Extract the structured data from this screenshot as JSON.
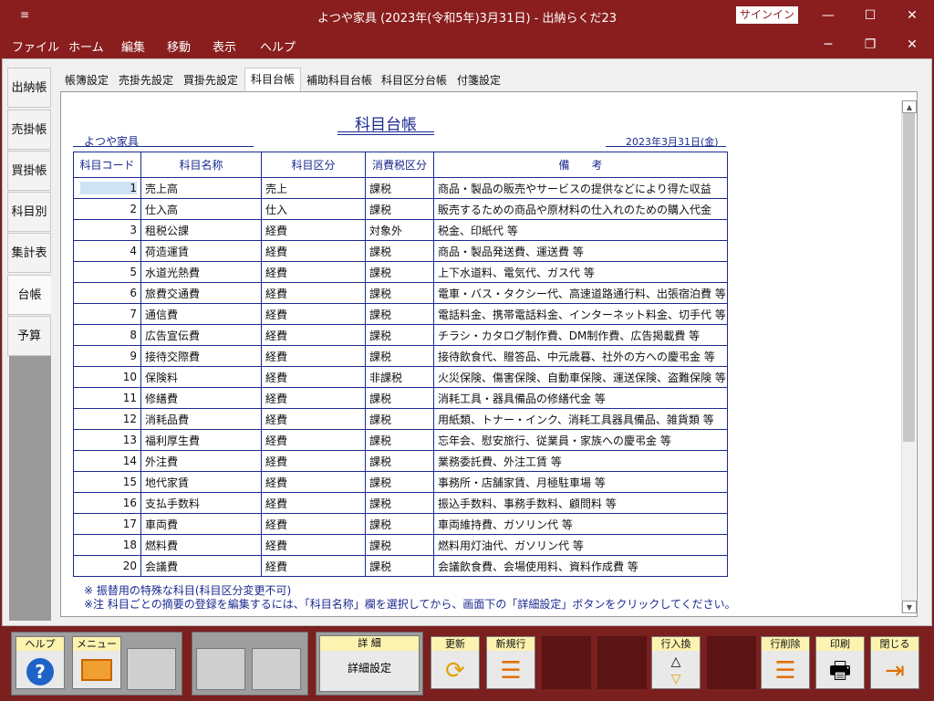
{
  "window": {
    "title": "よつや家具 (2023年(令和5年)3月31日)  -  出納らくだ23",
    "signin_label": "サインイン",
    "menu_icon": "≡"
  },
  "menu": [
    "ファイル",
    "ホーム",
    "編集",
    "移動",
    "表示",
    "ヘルプ"
  ],
  "side_tabs": [
    "出納帳",
    "売掛帳",
    "買掛帳",
    "科目別",
    "集計表",
    "台帳",
    "予算"
  ],
  "active_side_tab": "台帳",
  "top_tabs": [
    "帳簿設定",
    "売掛先設定",
    "買掛先設定",
    "科目台帳",
    "補助科目台帳",
    "科目区分台帳",
    "付箋設定"
  ],
  "active_top_tab": "科目台帳",
  "document": {
    "title": "科目台帳",
    "company": "よつや家具",
    "date": "2023年3月31日(金)"
  },
  "table": {
    "headers": [
      "科目コード",
      "科目名称",
      "科目区分",
      "消費税区分",
      "備　　考"
    ],
    "rows": [
      [
        "1",
        "売上高",
        "売上",
        "課税",
        "商品・製品の販売やサービスの提供などにより得た収益"
      ],
      [
        "2",
        "仕入高",
        "仕入",
        "課税",
        "販売するための商品や原材料の仕入れのための購入代金"
      ],
      [
        "3",
        "租税公課",
        "経費",
        "対象外",
        "税金、印紙代 等"
      ],
      [
        "4",
        "荷造運賃",
        "経費",
        "課税",
        "商品・製品発送費、運送費 等"
      ],
      [
        "5",
        "水道光熱費",
        "経費",
        "課税",
        "上下水道料、電気代、ガス代 等"
      ],
      [
        "6",
        "旅費交通費",
        "経費",
        "課税",
        "電車・バス・タクシー代、高速道路通行料、出張宿泊費 等"
      ],
      [
        "7",
        "通信費",
        "経費",
        "課税",
        "電話料金、携帯電話料金、インターネット料金、切手代 等"
      ],
      [
        "8",
        "広告宣伝費",
        "経費",
        "課税",
        "チラシ・カタログ制作費、DM制作費、広告掲載費 等"
      ],
      [
        "9",
        "接待交際費",
        "経費",
        "課税",
        "接待飲食代、贈答品、中元歳暮、社外の方への慶弔金 等"
      ],
      [
        "10",
        "保険料",
        "経費",
        "非課税",
        "火災保険、傷害保険、自動車保険、運送保険、盗難保険 等"
      ],
      [
        "11",
        "修繕費",
        "経費",
        "課税",
        "消耗工具・器具備品の修繕代金 等"
      ],
      [
        "12",
        "消耗品費",
        "経費",
        "課税",
        "用紙類、トナー・インク、消耗工具器具備品、雑貨類 等"
      ],
      [
        "13",
        "福利厚生費",
        "経費",
        "課税",
        "忘年会、慰安旅行、従業員・家族への慶弔金 等"
      ],
      [
        "14",
        "外注費",
        "経費",
        "課税",
        "業務委託費、外注工賃 等"
      ],
      [
        "15",
        "地代家賃",
        "経費",
        "課税",
        "事務所・店舗家賃、月極駐車場 等"
      ],
      [
        "16",
        "支払手数料",
        "経費",
        "課税",
        "振込手数料、事務手数料、顧問料 等"
      ],
      [
        "17",
        "車両費",
        "経費",
        "課税",
        "車両維持費、ガソリン代 等"
      ],
      [
        "18",
        "燃料費",
        "経費",
        "課税",
        "燃料用灯油代、ガソリン代 等"
      ],
      [
        "20",
        "会議費",
        "経費",
        "課税",
        "会議飲食費、会場使用料、資料作成費 等"
      ]
    ]
  },
  "notes": [
    "※ 振替用の特殊な科目(科目区分変更不可)",
    "※注  科目ごとの摘要の登録を編集するには、「科目名称」欄を選択してから、画面下の「詳細設定」ボタンをクリックしてください。"
  ],
  "toolbar": {
    "help": "ヘルプ",
    "menu": "メニュー",
    "detail_label": "詳 細",
    "detail_text": "詳細設定",
    "update": "更新",
    "new_row": "新規行",
    "row_swap": "行入換",
    "delete_row": "行削除",
    "print": "印刷",
    "close": "閉じる"
  },
  "colors": {
    "chrome": "#8a1e1e",
    "ink": "#1b2a8f",
    "button_label": "#fdf3b0"
  }
}
